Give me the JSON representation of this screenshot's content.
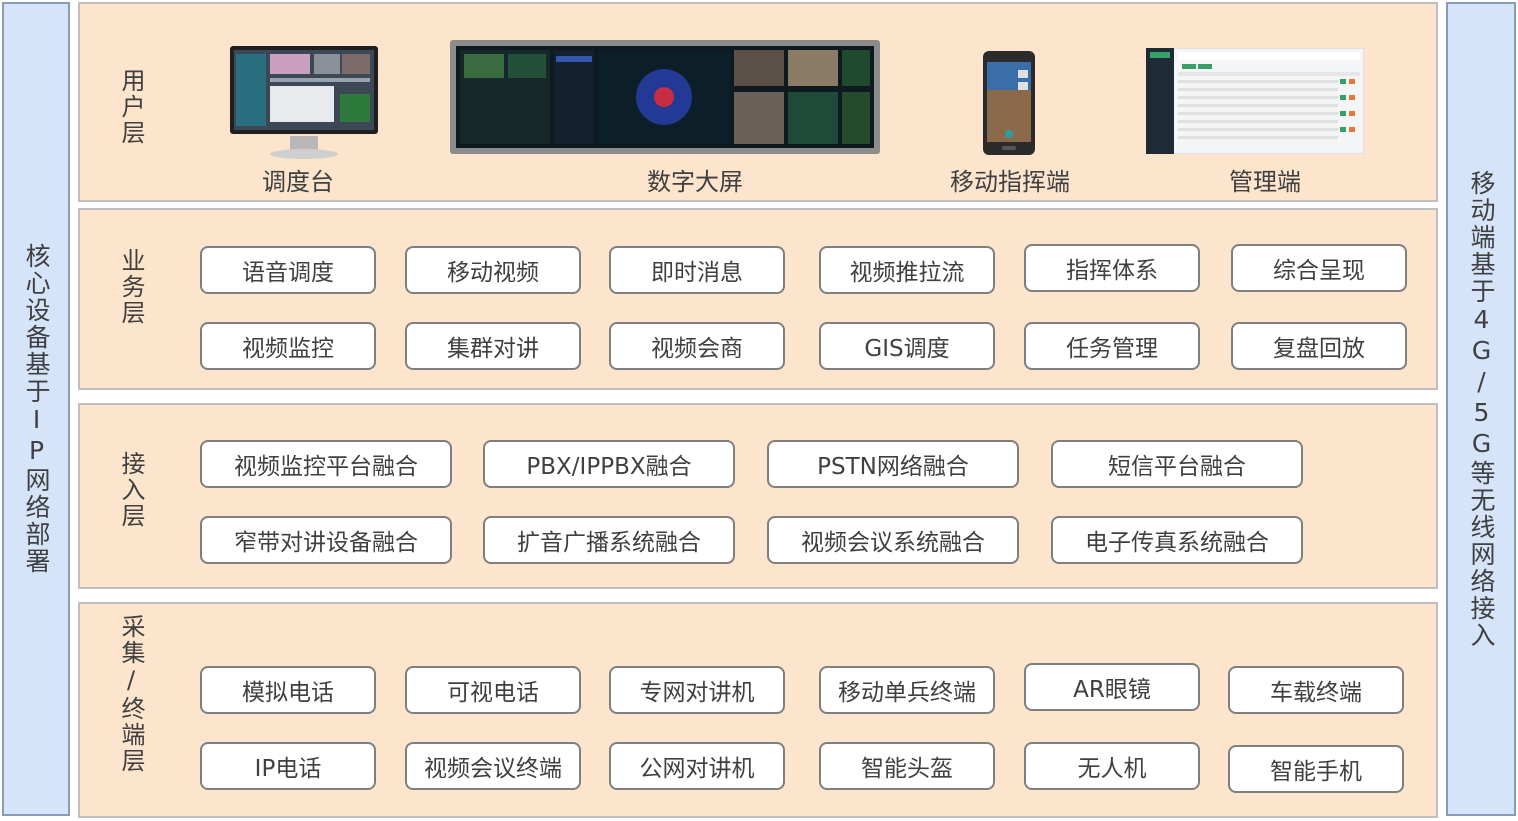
{
  "left_side": "核心设备基于IP网络部署",
  "right_side": "移动端基于4G/5G等无线网络接入",
  "layers": {
    "user": {
      "label": "用户层",
      "items": [
        "调度台",
        "数字大屏",
        "移动指挥端",
        "管理端"
      ]
    },
    "business": {
      "label": "业务层",
      "rows": [
        [
          "语音调度",
          "移动视频",
          "即时消息",
          "视频推拉流",
          "指挥体系",
          "综合呈现"
        ],
        [
          "视频监控",
          "集群对讲",
          "视频会商",
          "GIS调度",
          "任务管理",
          "复盘回放"
        ]
      ]
    },
    "access": {
      "label": "接入层",
      "rows": [
        [
          "视频监控平台融合",
          "PBX/IPPBX融合",
          "PSTN网络融合",
          "短信平台融合"
        ],
        [
          "窄带对讲设备融合",
          "扩音广播系统融合",
          "视频会议系统融合",
          "电子传真系统融合"
        ]
      ]
    },
    "terminal": {
      "label": "采集/终端层",
      "rows": [
        [
          "模拟电话",
          "可视电话",
          "专网对讲机",
          "移动单兵终端",
          "AR眼镜",
          "车载终端"
        ],
        [
          "IP电话",
          "视频会议终端",
          "公网对讲机",
          "智能头盔",
          "无人机",
          "智能手机"
        ]
      ]
    }
  },
  "colors": {
    "layer_bg": "#fce5cc",
    "side_bg": "#d6e4fa",
    "box_border": "#7f7f7f"
  }
}
